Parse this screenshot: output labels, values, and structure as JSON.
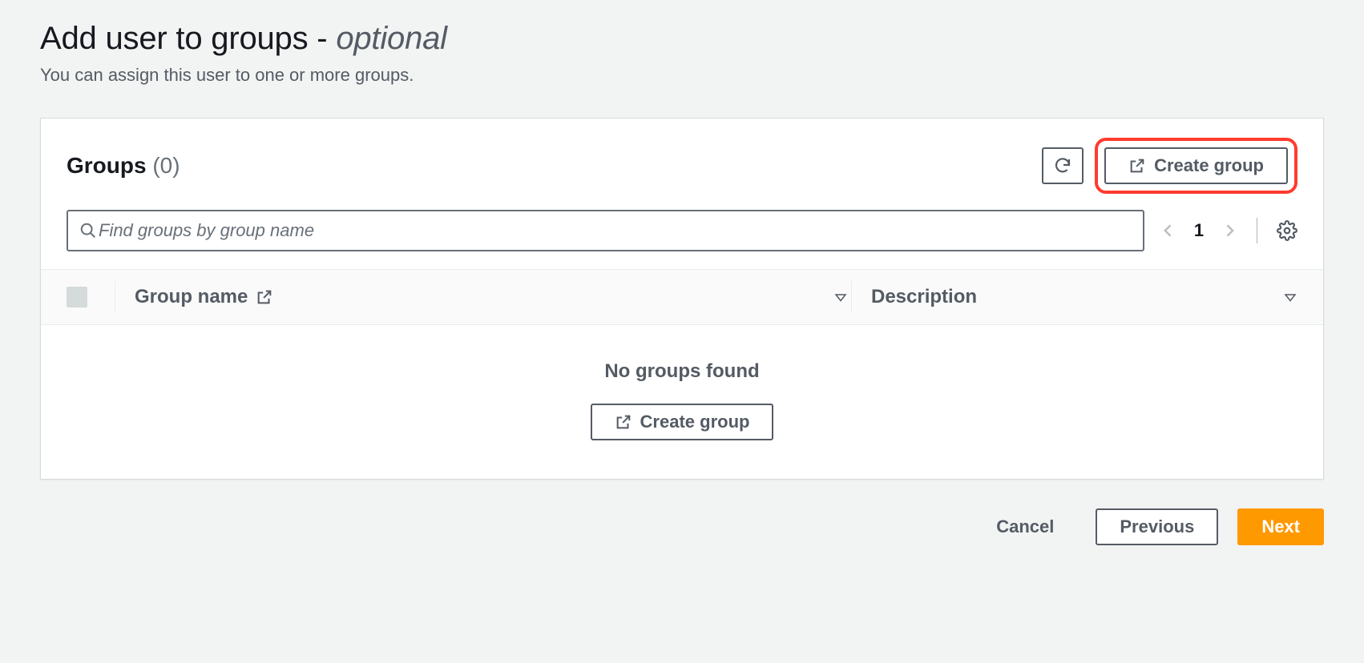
{
  "header": {
    "title_main": "Add user to groups",
    "title_separator": " - ",
    "title_suffix": "optional",
    "subtitle": "You can assign this user to one or more groups."
  },
  "panel": {
    "title": "Groups",
    "count": "(0)",
    "create_label": "Create group",
    "search_placeholder": "Find groups by group name",
    "pagination": {
      "page": "1"
    }
  },
  "table": {
    "columns": {
      "name": "Group name",
      "description": "Description"
    },
    "empty_message": "No groups found",
    "empty_action": "Create group",
    "rows": []
  },
  "footer": {
    "cancel": "Cancel",
    "previous": "Previous",
    "next": "Next"
  }
}
